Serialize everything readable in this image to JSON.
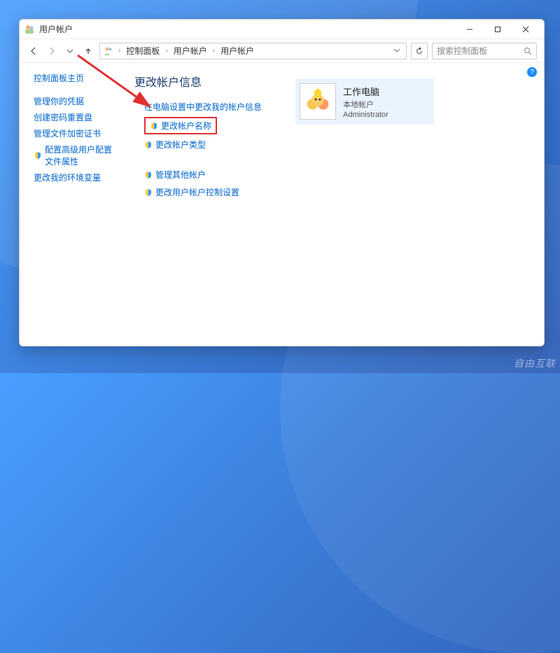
{
  "window": {
    "title": "用户帐户"
  },
  "breadcrumb": {
    "items": [
      "控制面板",
      "用户帐户",
      "用户帐户"
    ]
  },
  "search": {
    "placeholder": "搜索控制面板"
  },
  "sidebar": {
    "items": [
      {
        "label": "控制面板主页",
        "shield": false
      },
      {
        "label": "管理你的凭据",
        "shield": false
      },
      {
        "label": "创建密码重置盘",
        "shield": false
      },
      {
        "label": "管理文件加密证书",
        "shield": false
      },
      {
        "label": "配置高级用户配置文件属性",
        "shield": true
      },
      {
        "label": "更改我的环境变量",
        "shield": false
      }
    ]
  },
  "main": {
    "heading": "更改帐户信息",
    "tasks": [
      {
        "label": "在电脑设置中更改我的帐户信息",
        "shield": false,
        "highlight": false
      },
      {
        "label": "更改帐户名称",
        "shield": true,
        "highlight": true
      },
      {
        "label": "更改帐户类型",
        "shield": true,
        "highlight": false
      }
    ],
    "tasks2": [
      {
        "label": "管理其他帐户",
        "shield": true
      },
      {
        "label": "更改用户帐户控制设置",
        "shield": true
      }
    ]
  },
  "account": {
    "name": "工作电脑",
    "type": "本地帐户",
    "role": "Administrator"
  },
  "help": "?",
  "watermark": "自由互联"
}
